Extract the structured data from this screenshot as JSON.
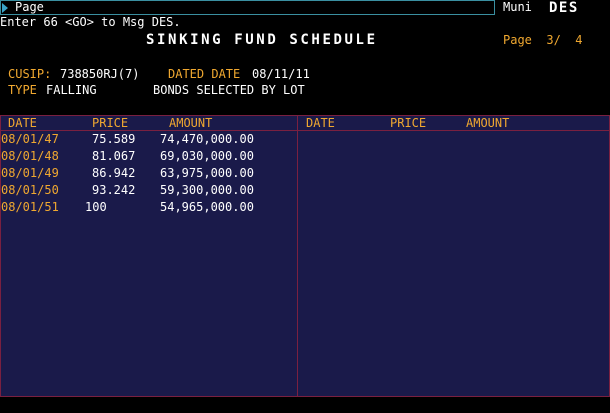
{
  "command_bar": {
    "input_value": "Page",
    "right_label": "Muni",
    "function_code": "DES"
  },
  "message": "Enter 66 <GO> to Msg DES.",
  "title": "SINKING FUND SCHEDULE",
  "page_indicator": "Page  3/  4",
  "security": {
    "cusip_label": "CUSIP:",
    "cusip_value": "738850RJ(7)",
    "dated_label": "DATED DATE",
    "dated_value": "08/11/11",
    "type_label": "TYPE",
    "type_value": "FALLING",
    "selection": "BONDS SELECTED BY LOT"
  },
  "table": {
    "headers": {
      "date": "DATE",
      "price": "PRICE",
      "amount": "AMOUNT"
    },
    "left_rows": [
      {
        "date": "08/01/47",
        "price": "75.589",
        "amount": "74,470,000.00"
      },
      {
        "date": "08/01/48",
        "price": "81.067",
        "amount": "69,030,000.00"
      },
      {
        "date": "08/01/49",
        "price": "86.942",
        "amount": "63,975,000.00"
      },
      {
        "date": "08/01/50",
        "price": "93.242",
        "amount": "59,300,000.00"
      },
      {
        "date": "08/01/51",
        "price": "100",
        "amount": "54,965,000.00"
      }
    ],
    "right_rows": []
  },
  "colors": {
    "background": "#000000",
    "panel": "#1a1a4a",
    "panel_border": "#7a2040",
    "amber": "#f0a830",
    "text": "#ffffff"
  }
}
